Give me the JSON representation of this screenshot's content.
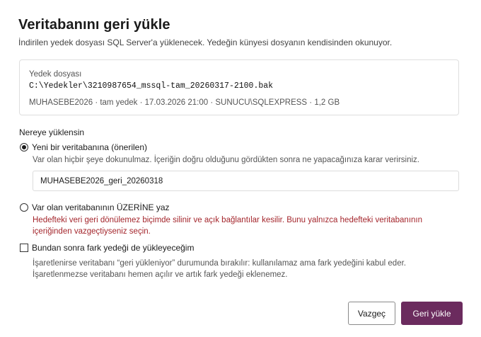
{
  "dialog": {
    "title": "Veritabanını geri yükle",
    "subtitle": "İndirilen yedek dosyası SQL Server'a yüklenecek. Yedeğin künyesi dosyanın kendisinden okunuyor."
  },
  "backup": {
    "label": "Yedek dosyası",
    "path": "C:\\Yedekler\\3210987654_mssql-tam_20260317-2100.bak",
    "meta": "MUHASEBE2026 · tam yedek · 17.03.2026 21:00 · SUNUCU\\SQLEXPRESS · 1,2 GB"
  },
  "target": {
    "section_label": "Nereye yüklensin",
    "new_db": {
      "label": "Yeni bir veritabanına (önerilen)",
      "description": "Var olan hiçbir şeye dokunulmaz. İçeriğin doğru olduğunu gördükten sonra ne yapacağınıza karar verirsiniz.",
      "name_value": "MUHASEBE2026_geri_20260318",
      "selected": true
    },
    "overwrite": {
      "label": "Var olan veritabanının ÜZERİNE yaz",
      "warning_line1": "Hedefteki veri geri dönülemez biçimde silinir ve açık bağlantılar kesilir. Bunu yalnızca hedefteki veritabanının",
      "warning_line2": "içeriğinden vazgeçtiyseniz seçin.",
      "selected": false
    }
  },
  "diff_option": {
    "label": "Bundan sonra fark yedeği de yükleyeceğim",
    "description_line1": "İşaretlenirse veritabanı “geri yükleniyor” durumunda bırakılır: kullanılamaz ama fark yedeğini kabul eder.",
    "description_line2": "İşaretlenmezse veritabanı hemen açılır ve artık fark yedeği eklenemez.",
    "checked": false
  },
  "buttons": {
    "cancel": "Vazgeç",
    "restore": "Geri yükle"
  },
  "colors": {
    "primary": "#6b2b5e",
    "warning": "#a4262c"
  }
}
